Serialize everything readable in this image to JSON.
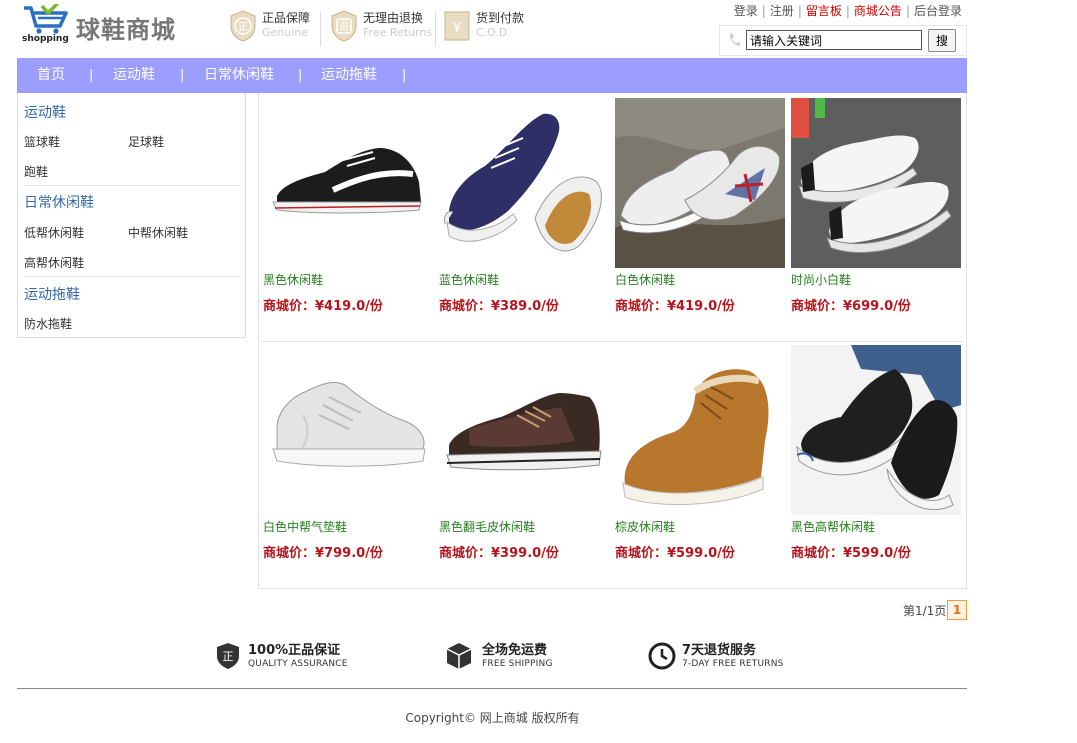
{
  "header": {
    "site_title": "球鞋商城",
    "logo_text": "shopping",
    "badges": [
      {
        "title": "正品保障",
        "subtitle": "Genuine",
        "glyph": "正"
      },
      {
        "title": "无理由退换",
        "subtitle": "Free Returns",
        "glyph": "退"
      },
      {
        "title": "货到付款",
        "subtitle": "C.O.D",
        "glyph": "¥"
      }
    ],
    "links": {
      "login": "登录",
      "register": "注册",
      "guestbook": "留言板",
      "announcement": "商城公告",
      "admin": "后台登录"
    },
    "search": {
      "value": "请输入关键词",
      "button": "搜"
    }
  },
  "nav": {
    "items": [
      "首页",
      "运动鞋",
      "日常休闲鞋",
      "运动拖鞋"
    ],
    "separator": "|",
    "color": "#9b9dff"
  },
  "sidebar": {
    "categories": [
      {
        "title": "运动鞋",
        "items": [
          "篮球鞋",
          "足球鞋",
          "跑鞋"
        ]
      },
      {
        "title": "日常休闲鞋",
        "items": [
          "低帮休闲鞋",
          "中帮休闲鞋",
          "高帮休闲鞋"
        ]
      },
      {
        "title": "运动拖鞋",
        "items": [
          "防水拖鞋"
        ]
      }
    ]
  },
  "price_label": "商城价：",
  "products": [
    {
      "name": "黑色休闲鞋",
      "price": "¥419.0/份"
    },
    {
      "name": "蓝色休闲鞋",
      "price": "¥389.0/份"
    },
    {
      "name": "白色休闲鞋",
      "price": "¥419.0/份"
    },
    {
      "name": "时尚小白鞋",
      "price": "¥699.0/份"
    },
    {
      "name": "白色中帮气垫鞋",
      "price": "¥799.0/份"
    },
    {
      "name": "黑色翻毛皮休闲鞋",
      "price": "¥399.0/份"
    },
    {
      "name": "棕皮休闲鞋",
      "price": "¥599.0/份"
    },
    {
      "name": "黑色高帮休闲鞋",
      "price": "¥599.0/份"
    }
  ],
  "pagination": {
    "info": "第1/1页",
    "current": "1"
  },
  "footer": {
    "features": [
      {
        "title": "100%正品保证",
        "subtitle": "QUALITY ASSURANCE"
      },
      {
        "title": "全场免运费",
        "subtitle": "FREE SHIPPING"
      },
      {
        "title": "7天退货服务",
        "subtitle": "7-DAY FREE RETURNS"
      }
    ],
    "copyright": "Copyright© 网上商城 版权所有"
  }
}
